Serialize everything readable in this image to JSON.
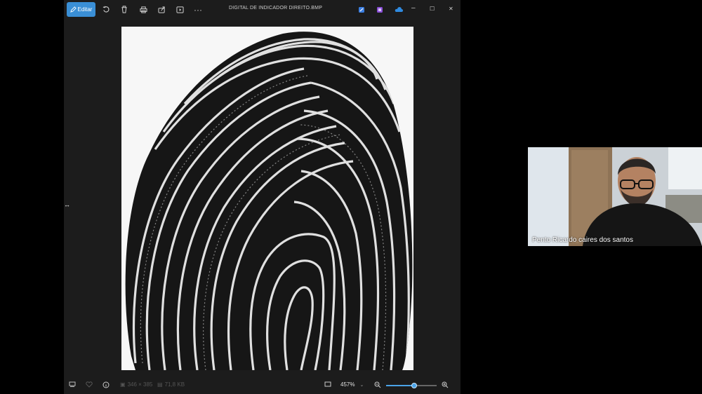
{
  "viewer": {
    "title": "DIGITAL DE INDICADOR DIREITO.BMP",
    "edit_label": "Editar",
    "more_label": "···",
    "min_label": "–",
    "max_label": "☐",
    "close_label": "✕"
  },
  "statusbar": {
    "dimensions": "346 × 385",
    "file_size": "71,8 KB",
    "zoom_level": "457%",
    "zoom_fraction": 0.55
  },
  "webcam": {
    "participant_name": "Pento Ricardo caires dos santos"
  },
  "icons": {
    "edit": "pencil-icon",
    "rotate": "rotate-icon",
    "delete": "trash-icon",
    "print": "printer-icon",
    "share": "share-icon",
    "slideshow": "slideshow-icon",
    "more": "more-icon",
    "filmstrip": "filmstrip-icon",
    "favorite": "heart-icon",
    "info": "info-icon",
    "fit": "fit-window-icon",
    "zoom_out": "zoom-out-icon",
    "zoom_in": "zoom-in-icon"
  },
  "colors": {
    "accent": "#3a8fd6",
    "window_bg": "#1c1c1c",
    "page_bg": "#000000"
  }
}
